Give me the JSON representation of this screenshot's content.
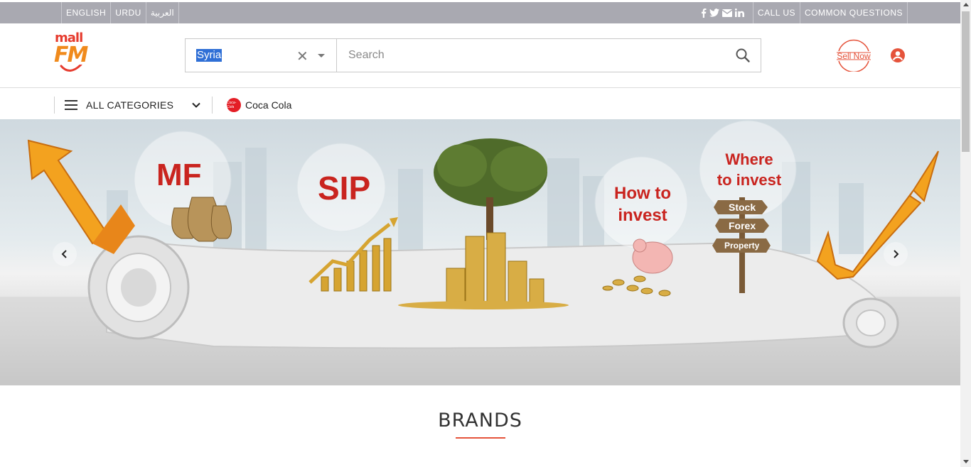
{
  "topbar": {
    "languages": [
      "ENGLISH",
      "URDU",
      "العربية"
    ],
    "social_icons": [
      "facebook-icon",
      "twitter-icon",
      "envelope-icon",
      "linkedin-icon"
    ],
    "call_us": "CALL US",
    "common_questions": "COMMON QUESTIONS"
  },
  "header": {
    "logo_top": "mall",
    "logo_bottom": "FM",
    "country": {
      "value": "Syria"
    },
    "search": {
      "placeholder": "Search",
      "value": ""
    },
    "sell_now": "Sell Now"
  },
  "nav": {
    "categories_label": "ALL CATEGORIES",
    "brand_link": "Coca Cola",
    "brand_logo_text": "Coca-Cola"
  },
  "hero": {
    "labels": {
      "mf": "MF",
      "sip": "SIP",
      "how_line1": "How to",
      "how_line2": "invest",
      "where_line1": "Where",
      "where_line2": "to invest"
    },
    "signpost": [
      "Stock",
      "Forex",
      "Property"
    ]
  },
  "brands": {
    "title": "BRANDS"
  },
  "colors": {
    "topbar_bg": "#a9a9b1",
    "accent": "#e5533b",
    "banner_red": "#c9241f",
    "selection": "#2f6fd6"
  }
}
